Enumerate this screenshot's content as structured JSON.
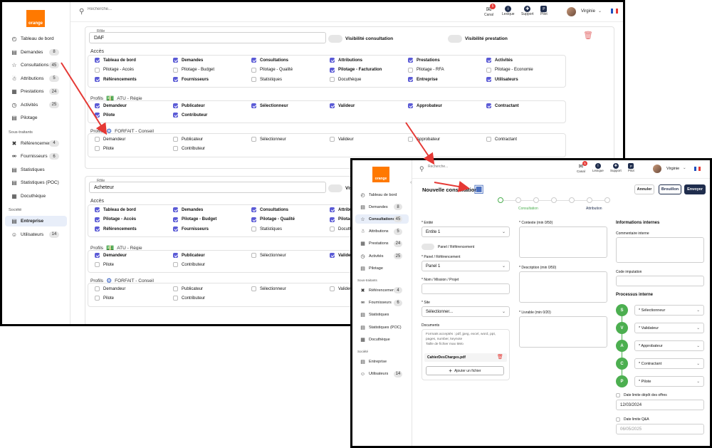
{
  "logo_text": "orange",
  "search_placeholder": "Recherche...",
  "topbar": {
    "canal": "Canal",
    "canal_badge": "5",
    "lexique": "Lexique",
    "support": "Support",
    "pilot": "Pilot",
    "user": "Virginie"
  },
  "nav_a": [
    {
      "label": "Tableau de bord",
      "badge": ""
    },
    {
      "label": "Demandes",
      "badge": "8"
    },
    {
      "label": "Consultations",
      "badge": "45"
    },
    {
      "label": "Attributions",
      "badge": "5"
    },
    {
      "label": "Prestations",
      "badge": "24"
    },
    {
      "label": "Activités",
      "badge": "25"
    },
    {
      "label": "Pilotage",
      "badge": ""
    }
  ],
  "nav_b": [
    {
      "label": "Tableau de bord",
      "badge": ""
    },
    {
      "label": "Demandes",
      "badge": "8"
    },
    {
      "label": "Consultations",
      "badge": "45"
    },
    {
      "label": "Attributions",
      "badge": "5"
    },
    {
      "label": "Prestations",
      "badge": "24"
    },
    {
      "label": "Activités",
      "badge": "25"
    },
    {
      "label": "Pilotage",
      "badge": ""
    }
  ],
  "sous_traitants": {
    "title": "Sous-traitants",
    "items": [
      {
        "label": "Référencements",
        "badge": "4"
      },
      {
        "label": "Fournisseurs",
        "badge": "6"
      },
      {
        "label": "Statistiques",
        "badge": ""
      },
      {
        "label": "Statistiques (POC)",
        "badge": ""
      },
      {
        "label": "Docuthèque",
        "badge": ""
      }
    ]
  },
  "societe": {
    "title": "Société",
    "items": [
      {
        "label": "Entreprise",
        "badge": ""
      },
      {
        "label": "Utilisateurs",
        "badge": "14"
      }
    ]
  },
  "role_label": "Rôle",
  "role1": "DAF",
  "role2": "Acheteur",
  "visibilite_consultation": "Visibilité consultation",
  "visibilite_prestation": "Visibilité prestation",
  "visibilite_short": "Visi",
  "acces_title": "Accès",
  "acces": [
    [
      "Tableau de bord",
      "Demandes",
      "Consultations",
      "Attributions",
      "Prestations",
      "Activités"
    ],
    [
      "Pilotage - Accès",
      "Pilotage - Budget",
      "Pilotage - Qualité",
      "Pilotage - Facturation",
      "Pilotage - RFA",
      "Pilotage - Economie"
    ],
    [
      "Référencements",
      "Fournisseurs",
      "Statistiques",
      "Docuthèque",
      "Entreprise",
      "Utilisateurs"
    ]
  ],
  "profils": "Profils",
  "profile_atu": "ATU - Régie",
  "profile_forfait": "FORFAIT - Conseil",
  "roles_row1": [
    "Demandeur",
    "Publicateur",
    "Sélectionneur",
    "Valideur",
    "Approbateur",
    "Contractant"
  ],
  "roles_row2": [
    "Pilote",
    "Contributeur"
  ],
  "consult": {
    "title": "Nouvelle consultation",
    "btn_annuler": "Annuler",
    "btn_brouillon": "Brouillon",
    "btn_envoyer": "Envoyer",
    "step1": "Consultation",
    "step2": "Attribution",
    "entite_label": "* Entité",
    "entite": "Entite 1",
    "panel_toggle": "Panel / Référencement",
    "panel_label": "* Panel / Référencement",
    "panel": "Panel 1",
    "nom_label": "* Nom / Mission / Projet",
    "site_label": "* Site",
    "site": "Sélectionner...",
    "documents": "Documents",
    "formats": "Formats acceptés : pdf, jpeg, excel, word, ppt, pages, number, keynote",
    "taille": "Taille de fichier max 5Mo",
    "file": "CahierDesCharges.pdf",
    "add_file": "Ajouter un fichier",
    "contexte": "* Contexte (min 0/50)",
    "description": "* Description (min 0/50)",
    "livrable": "* Livrable (min 0/20)",
    "infos": "Informations internes",
    "commentaire": "Commentaire interne",
    "code": "Code imputation",
    "processus": "Processus interne",
    "process": [
      {
        "letter": "S",
        "label": "* Sélectionneur"
      },
      {
        "letter": "V",
        "label": "* Validateur"
      },
      {
        "letter": "A",
        "label": "* Approbateur"
      },
      {
        "letter": "C",
        "label": "* Contractant"
      },
      {
        "letter": "P",
        "label": "* Pilote"
      }
    ],
    "date_depot_label": "Date limite dépôt des offres",
    "date_depot": "12/03/2024",
    "date_qa_label": "Date limite Q&A",
    "date_qa": "06/05/2025"
  },
  "colors": {
    "orange": "#ff7900",
    "navy": "#1f2d4d",
    "check": "#5b5bd6",
    "green": "#4caf50",
    "red": "#e53935"
  }
}
